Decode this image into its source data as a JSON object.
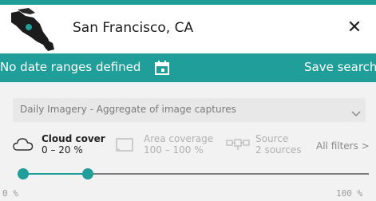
{
  "header": {
    "location": "San Francisco, CA",
    "close_icon": "close-icon",
    "map_thumbnail_icon": "map-thumbnail"
  },
  "date_bar": {
    "label": "No date ranges defined",
    "calendar_icon": "calendar-icon",
    "save_search_label": "Save search"
  },
  "imagery_select": {
    "selected": "Daily Imagery - Aggregate of image captures",
    "chevron_icon": "chevron-down-icon"
  },
  "filters": {
    "cloud_cover": {
      "title": "Cloud cover",
      "value": "0 – 20 %",
      "icon": "cloud-icon"
    },
    "area_coverage": {
      "title": "Area coverage",
      "value": "100 – 100 %",
      "icon": "area-icon"
    },
    "source": {
      "title": "Source",
      "value": "2 sources",
      "icon": "satellite-icon"
    },
    "all_filters_label": "All filters >"
  },
  "cloud_slider": {
    "min_label": "0 %",
    "max_label": "100 %",
    "low_fraction": 0.0,
    "high_fraction": 0.2
  },
  "colors": {
    "accent": "#1f9e9a",
    "white": "#ffffff"
  }
}
